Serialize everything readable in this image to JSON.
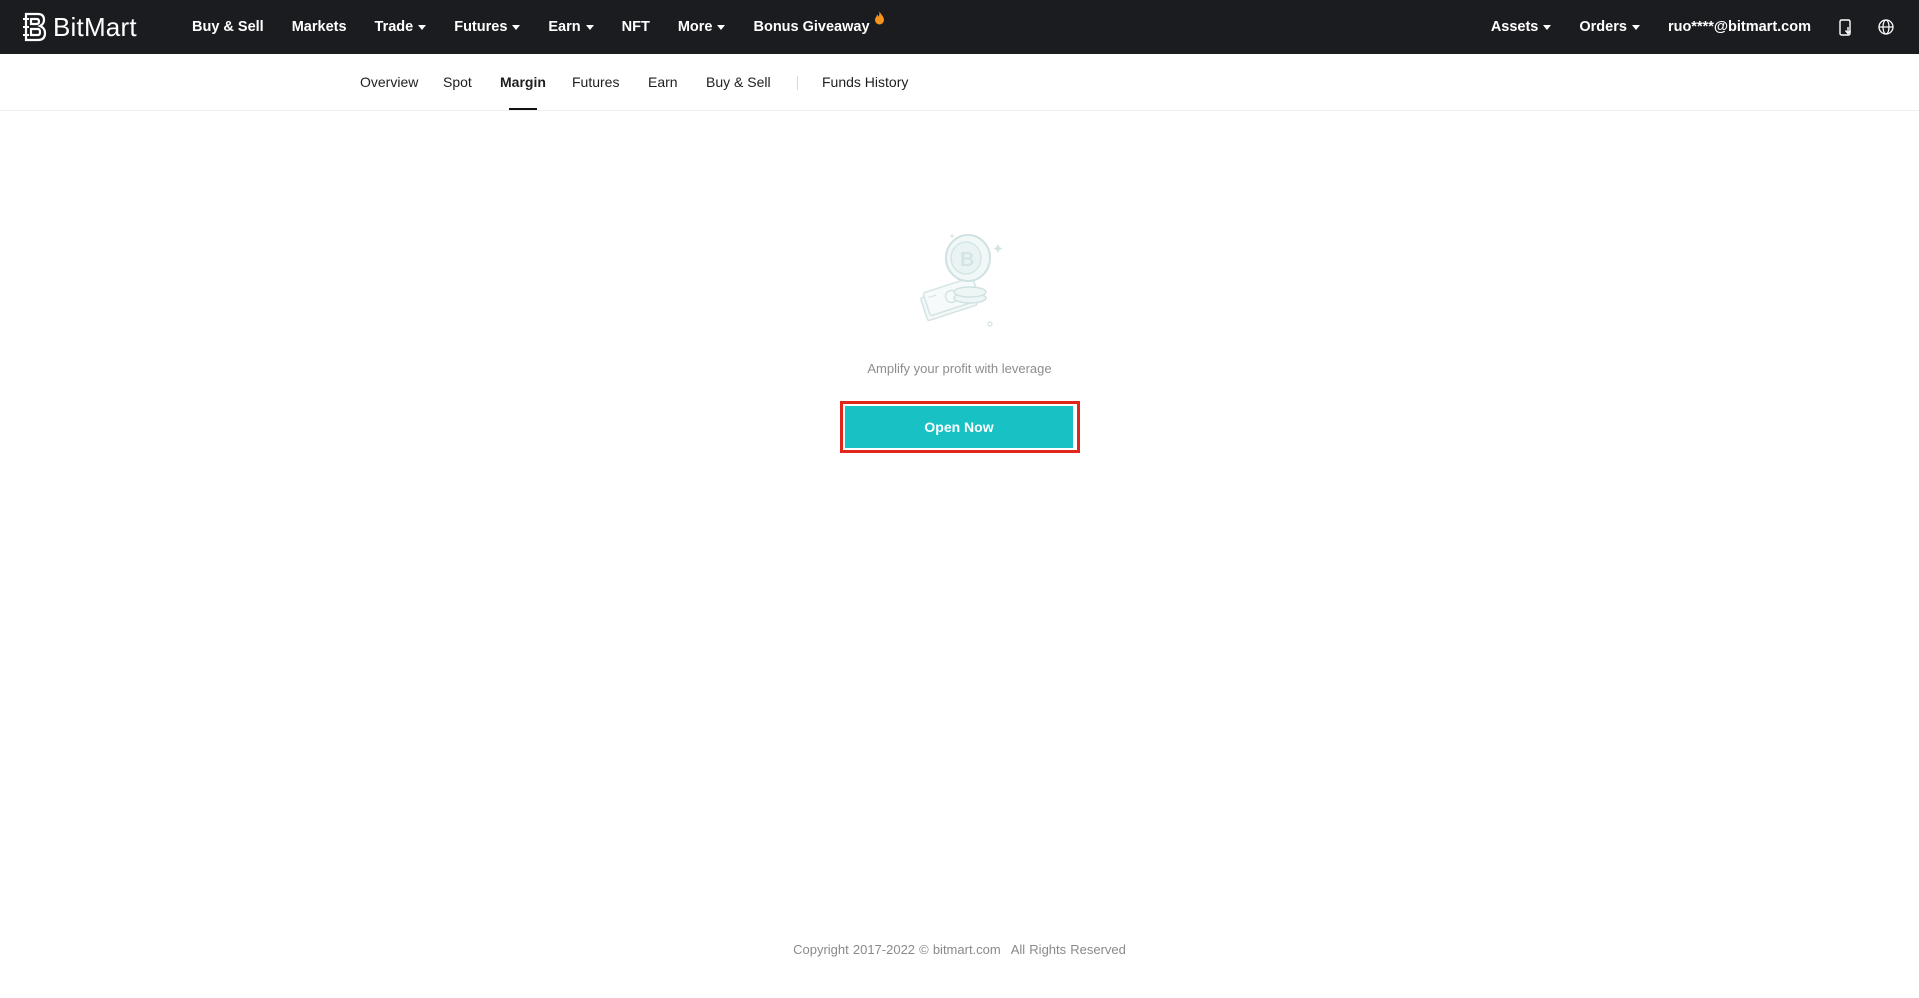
{
  "brand": {
    "name": "BitMart",
    "logo_icon": "bitmart-logo-icon"
  },
  "topnav": {
    "items": [
      {
        "label": "Buy & Sell",
        "dropdown": false
      },
      {
        "label": "Markets",
        "dropdown": false
      },
      {
        "label": "Trade",
        "dropdown": true
      },
      {
        "label": "Futures",
        "dropdown": true
      },
      {
        "label": "Earn",
        "dropdown": true
      },
      {
        "label": "NFT",
        "dropdown": false
      },
      {
        "label": "More",
        "dropdown": true
      },
      {
        "label": "Bonus Giveaway",
        "dropdown": false,
        "icon": "flame-icon"
      }
    ],
    "right": {
      "assets_label": "Assets",
      "orders_label": "Orders",
      "account_label": "ruo****@bitmart.com",
      "download_icon": "download-app-icon",
      "language_icon": "globe-icon"
    }
  },
  "subtabs": {
    "items": [
      "Overview",
      "Spot",
      "Margin",
      "Futures",
      "Earn",
      "Buy & Sell",
      "Funds History"
    ],
    "active": "Margin"
  },
  "empty_state": {
    "illustration_icon": "coins-cash-illustration",
    "message": "Amplify your profit with leverage",
    "button_label": "Open Now"
  },
  "footer": {
    "copyright": "Copyright 2017-2022 © bitmart.com",
    "rights": "All Rights Reserved"
  },
  "colors": {
    "topbar_bg": "#1b1c20",
    "accent": "#18c1c3",
    "highlight_border": "#e1261c",
    "flame": "#f7931a"
  }
}
